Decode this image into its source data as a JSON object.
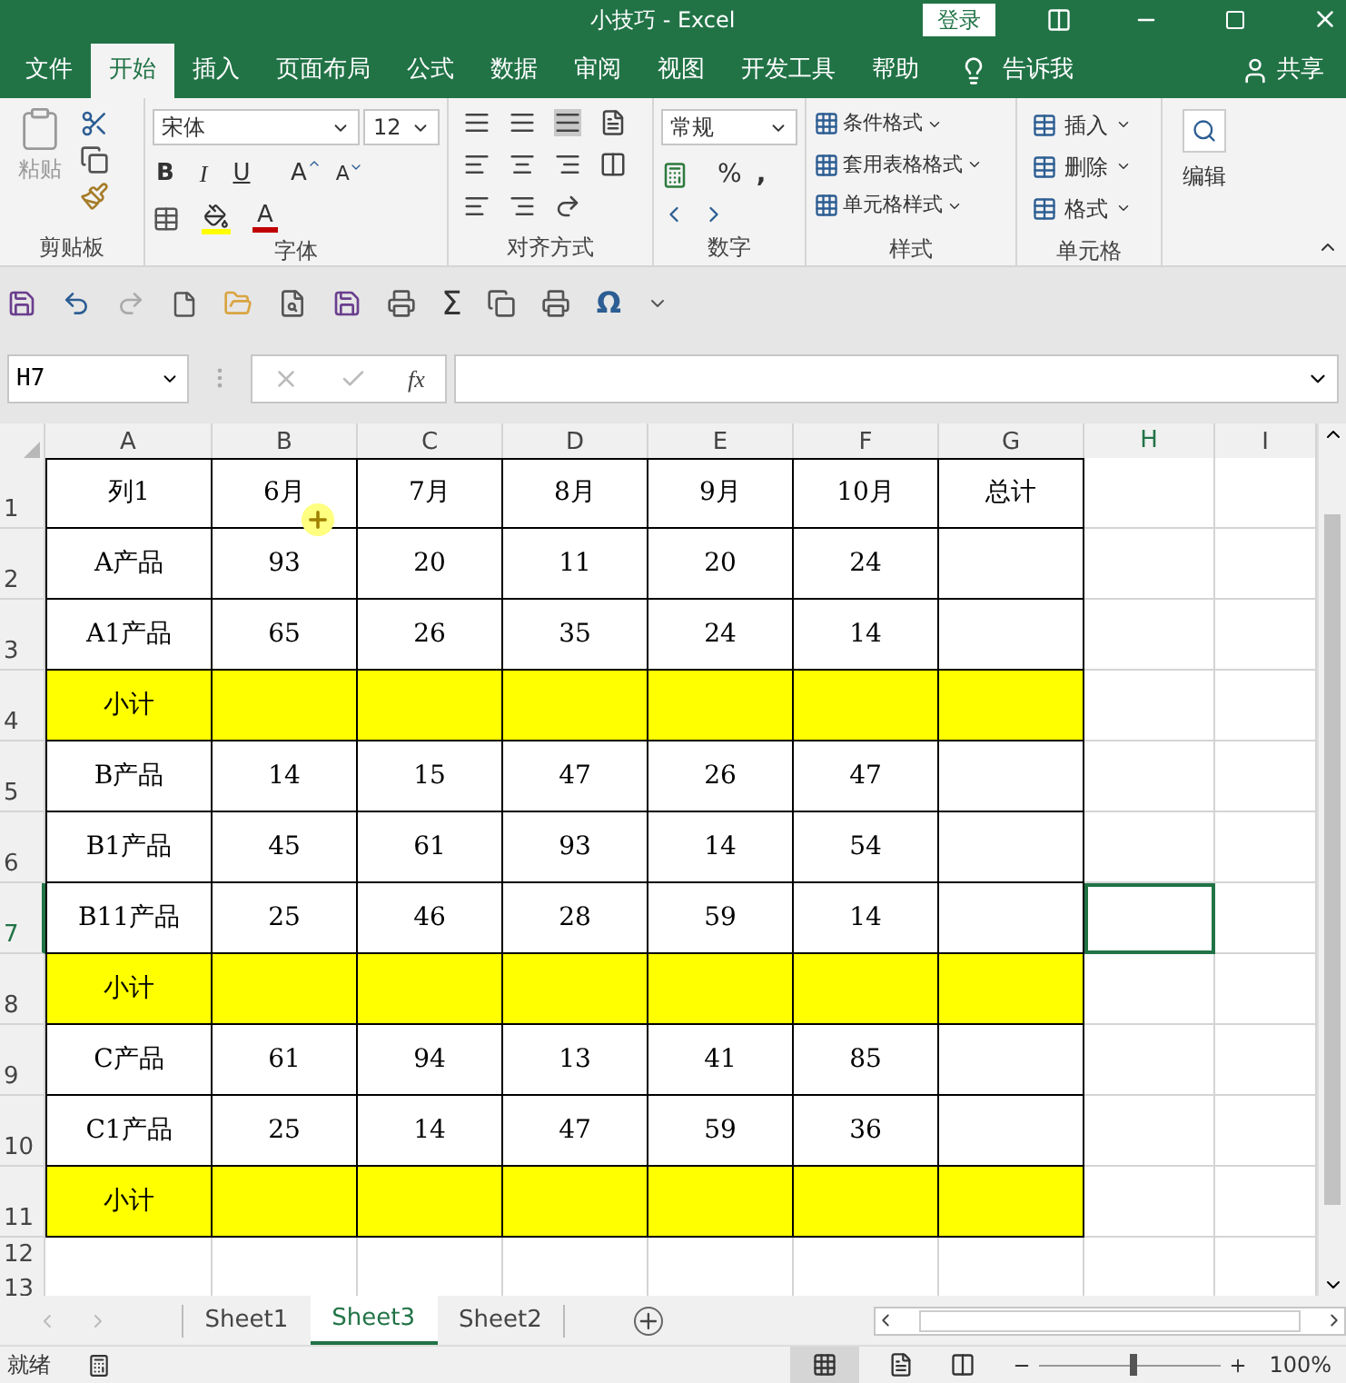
{
  "window": {
    "title": "小技巧  -  Excel",
    "login": "登录"
  },
  "menu_tabs": [
    {
      "label": "文件",
      "selected": false
    },
    {
      "label": "开始",
      "selected": true
    },
    {
      "label": "插入",
      "selected": false
    },
    {
      "label": "页面布局",
      "selected": false
    },
    {
      "label": "公式",
      "selected": false
    },
    {
      "label": "数据",
      "selected": false
    },
    {
      "label": "审阅",
      "selected": false
    },
    {
      "label": "视图",
      "selected": false
    },
    {
      "label": "开发工具",
      "selected": false
    },
    {
      "label": "帮助",
      "selected": false
    }
  ],
  "tell_me": "告诉我",
  "share": "共享",
  "ribbon": {
    "clipboard": {
      "paste": "粘贴",
      "label": "剪贴板"
    },
    "font": {
      "name": "宋体",
      "size": "12",
      "bold": "B",
      "italic": "I",
      "underline": "U",
      "grow": "A",
      "shrink": "A",
      "text_color": "A",
      "label": "字体"
    },
    "alignment": {
      "label": "对齐方式"
    },
    "number": {
      "format": "常规",
      "percent": "%",
      "comma": ",",
      "label": "数字"
    },
    "styles": {
      "items": [
        "条件格式",
        "套用表格格式",
        "单元格样式"
      ],
      "label": "样式"
    },
    "cells": {
      "items": [
        "插入",
        "删除",
        "格式"
      ],
      "label": "单元格"
    },
    "editing": {
      "label": "编辑"
    }
  },
  "quick_access": {
    "sum": "Σ",
    "symbol": "Ω"
  },
  "formula_bar": {
    "name_box": "H7",
    "fx": "fx"
  },
  "columns": [
    {
      "label": "A",
      "selected": false
    },
    {
      "label": "B",
      "selected": false
    },
    {
      "label": "C",
      "selected": false
    },
    {
      "label": "D",
      "selected": false
    },
    {
      "label": "E",
      "selected": false
    },
    {
      "label": "F",
      "selected": false
    },
    {
      "label": "G",
      "selected": false
    },
    {
      "label": "H",
      "selected": true
    },
    {
      "label": "I",
      "selected": false
    }
  ],
  "rows": [
    {
      "number": "1",
      "label": "列1",
      "values": [
        "6月",
        "7月",
        "8月",
        "9月",
        "10月",
        "总计"
      ],
      "highlighted": false,
      "selected": false
    },
    {
      "number": "2",
      "label": "A产品",
      "values": [
        "93",
        "20",
        "11",
        "20",
        "24"
      ],
      "highlighted": false,
      "selected": false
    },
    {
      "number": "3",
      "label": "A1产品",
      "values": [
        "65",
        "26",
        "35",
        "24",
        "14"
      ],
      "highlighted": false,
      "selected": false
    },
    {
      "number": "4",
      "label": "小计",
      "values": [],
      "highlighted": true,
      "selected": false
    },
    {
      "number": "5",
      "label": "B产品",
      "values": [
        "14",
        "15",
        "47",
        "26",
        "47"
      ],
      "highlighted": false,
      "selected": false
    },
    {
      "number": "6",
      "label": "B1产品",
      "values": [
        "45",
        "61",
        "93",
        "14",
        "54"
      ],
      "highlighted": false,
      "selected": false
    },
    {
      "number": "7",
      "label": "B11产品",
      "values": [
        "25",
        "46",
        "28",
        "59",
        "14"
      ],
      "highlighted": false,
      "selected": true
    },
    {
      "number": "8",
      "label": "小计",
      "values": [],
      "highlighted": true,
      "selected": false
    },
    {
      "number": "9",
      "label": "C产品",
      "values": [
        "61",
        "94",
        "13",
        "41",
        "85"
      ],
      "highlighted": false,
      "selected": false
    },
    {
      "number": "10",
      "label": "C1产品",
      "values": [
        "25",
        "14",
        "47",
        "59",
        "36"
      ],
      "highlighted": false,
      "selected": false
    },
    {
      "number": "11",
      "label": "小计",
      "values": [],
      "highlighted": true,
      "selected": false
    }
  ],
  "empty_rows": [
    "12",
    "13"
  ],
  "sheet_tabs": [
    {
      "label": "Sheet1",
      "selected": false
    },
    {
      "label": "Sheet3",
      "selected": true
    },
    {
      "label": "Sheet2",
      "selected": false
    }
  ],
  "status_bar": {
    "status": "就绪",
    "zoom": "100%",
    "zoom_slider": {
      "level": 0.5
    }
  }
}
